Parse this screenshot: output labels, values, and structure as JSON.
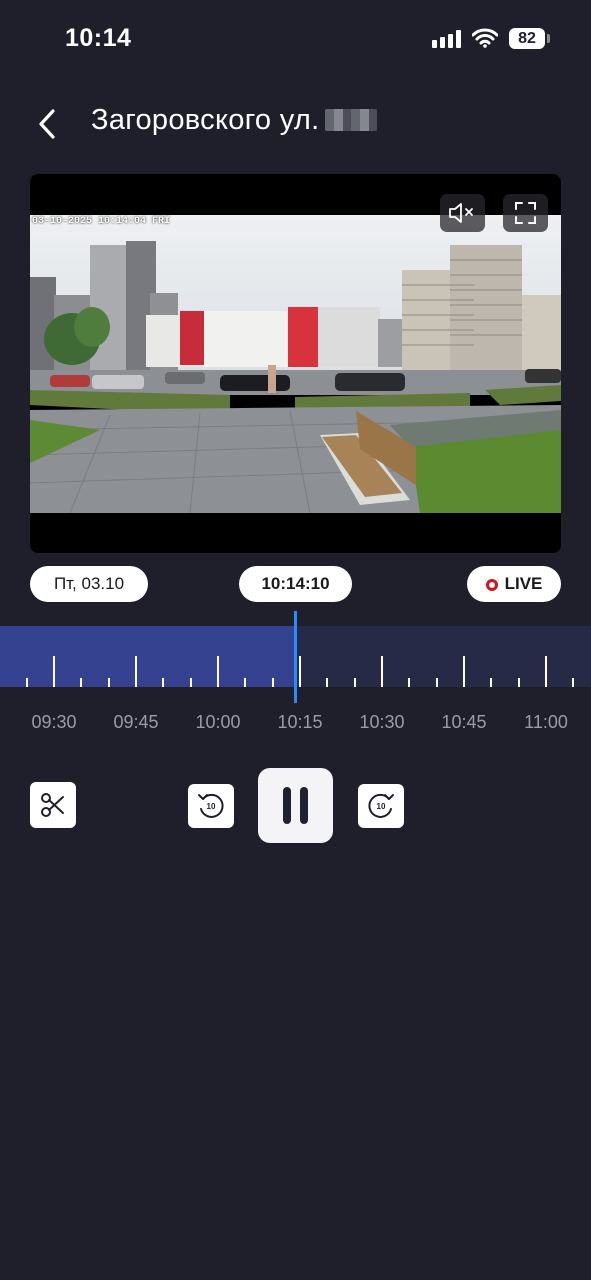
{
  "status_bar": {
    "time": "10:14",
    "battery": "82"
  },
  "header": {
    "title": "Загоровского ул."
  },
  "video": {
    "osd": "03-10-2025 10:14:04 FRI",
    "mute_icon": "speaker-muted-icon",
    "fullscreen_icon": "fullscreen-icon"
  },
  "chips": {
    "date": "Пт, 03.10",
    "current_time": "10:14:10",
    "live": "LIVE"
  },
  "timeline": {
    "labels": [
      "09:30",
      "09:45",
      "10:00",
      "10:15",
      "10:30",
      "10:45",
      "11:00"
    ],
    "recorded_until": "10:14:10"
  },
  "controls": {
    "clip_icon": "scissors-icon",
    "rewind_icon": "rewind-10-icon",
    "rewind_label": "10",
    "pause_icon": "pause-icon",
    "forward_icon": "forward-10-icon",
    "forward_label": "10"
  },
  "colors": {
    "background": "#1e1f2b",
    "timeline_recorded": "#34428f",
    "timeline_empty": "#272a47",
    "cursor": "#2a8bff",
    "live": "#d0161c"
  }
}
